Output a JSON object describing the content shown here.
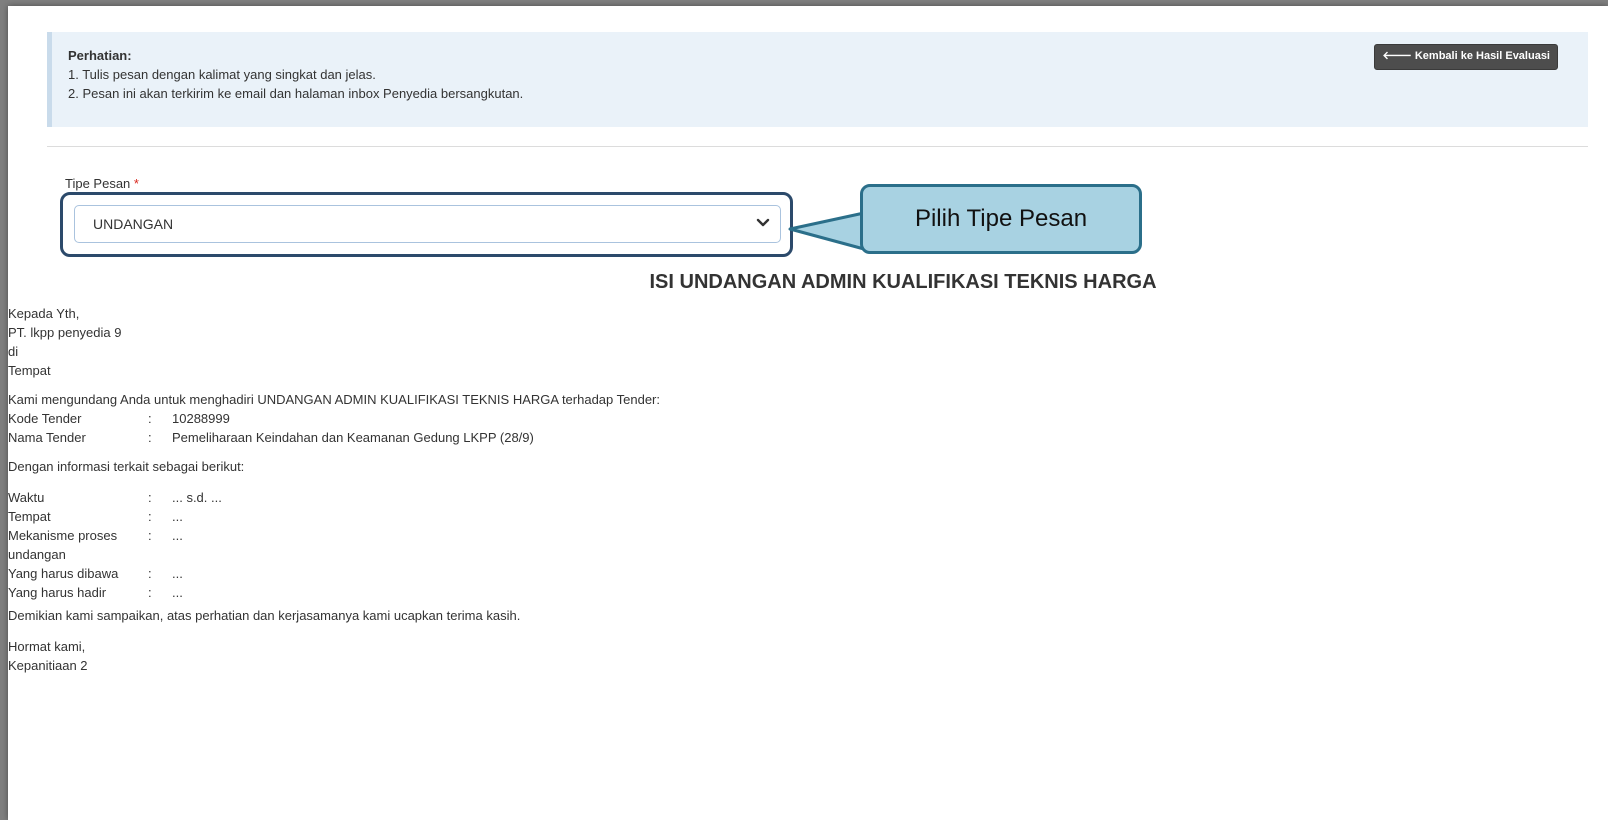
{
  "alert": {
    "title": "Perhatian:",
    "line1": "1. Tulis pesan dengan kalimat yang singkat dan jelas.",
    "line2": "2. Pesan ini akan terkirim ke email dan halaman inbox Penyedia bersangkutan.",
    "back_button": "🡐 Kembali ke Hasil Evaluasi"
  },
  "form": {
    "tipe_label": "Tipe Pesan",
    "required_mark": "*",
    "tipe_value": "UNDANGAN"
  },
  "callout": {
    "text": "Pilih Tipe Pesan"
  },
  "letter": {
    "heading": "ISI UNDANGAN ADMIN KUALIFIKASI TEKNIS HARGA",
    "to1": "Kepada Yth,",
    "to2": "PT. lkpp penyedia 9",
    "to3": "di",
    "to4": "Tempat",
    "intro": "Kami mengundang Anda untuk menghadiri UNDANGAN ADMIN KUALIFIKASI TEKNIS HARGA terhadap Tender:",
    "kode_label": "Kode Tender",
    "kode_value": "10288999",
    "nama_label": "Nama Tender",
    "nama_value": "Pemeliharaan Keindahan dan Keamanan Gedung LKPP (28/9)",
    "info_intro": "Dengan informasi terkait sebagai berikut:",
    "colon": ":",
    "waktu_label": "Waktu",
    "waktu_value": "... s.d. ...",
    "tempat_label": "Tempat",
    "tempat_value": "...",
    "mekanisme_label_1": "Mekanisme proses",
    "mekanisme_label_2": "undangan",
    "mekanisme_value": "...",
    "dibawa_label": "Yang harus dibawa",
    "dibawa_value": "...",
    "hadir_label": "Yang harus hadir",
    "hadir_value": "...",
    "closing": "Demikian kami sampaikan, atas perhatian dan kerjasamanya kami ucapkan terima kasih.",
    "sign1": "Hormat kami,",
    "sign2": "Kepanitiaan 2"
  },
  "colors": {
    "alert_bg": "#eaf2f9",
    "button_bg": "#4d4d4d",
    "highlight_border": "#2c4a6b",
    "callout_bg": "#a8d2e2",
    "callout_border": "#2b6f8a",
    "required": "#d9261c"
  },
  "icons": [
    "chevron-down-icon",
    "arrow-left-icon"
  ]
}
